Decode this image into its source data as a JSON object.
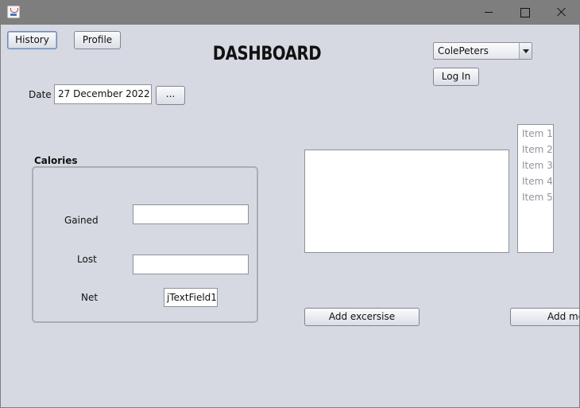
{
  "window": {
    "app_icon": "java-app-icon",
    "minimize_icon": "minimize-icon",
    "maximize_icon": "maximize-icon",
    "close_icon": "close-icon"
  },
  "nav": {
    "history_label": "History",
    "profile_label": "Profile"
  },
  "title": "DASHBOARD",
  "user": {
    "selected_user": "ColePeters",
    "login_label": "Log In"
  },
  "date": {
    "label": "Date",
    "value": "27 December 2022",
    "picker_label": "..."
  },
  "calories": {
    "heading": "Calories",
    "gained_label": "Gained",
    "gained_value": "",
    "lost_label": "Lost",
    "lost_value": "",
    "net_label": "Net",
    "net_value": "jTextField1"
  },
  "activity": {
    "notes_value": "",
    "list_items": [
      "Item 1",
      "Item 2",
      "Item 3",
      "Item 4",
      "Item 5"
    ],
    "add_exercise_label": "Add excersise",
    "add_meal_label": "Add me"
  },
  "colors": {
    "window_chrome": "#7e7e7e",
    "content_background": "#d6d9e1",
    "disabled_text": "#8f949c"
  }
}
